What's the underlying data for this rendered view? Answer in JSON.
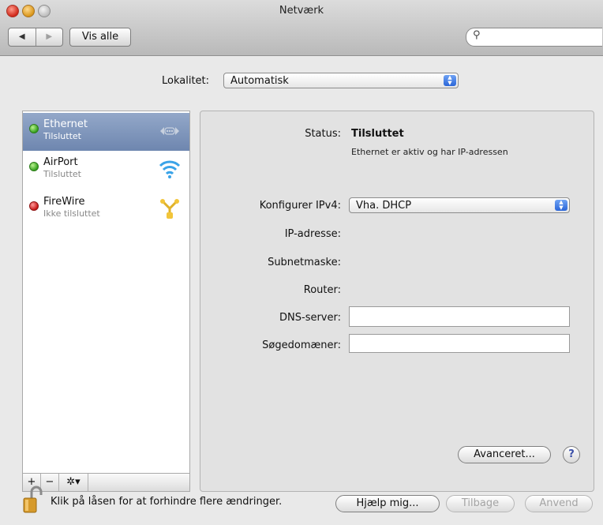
{
  "window": {
    "title": "Netværk"
  },
  "toolbar": {
    "back_glyph": "◀",
    "forward_glyph": "▶",
    "show_all_label": "Vis alle",
    "search_placeholder": ""
  },
  "location": {
    "label": "Lokalitet:",
    "value": "Automatisk"
  },
  "services": [
    {
      "name": "Ethernet",
      "status": "Tilsluttet",
      "status_color": "green",
      "icon": "ethernet-icon",
      "selected": true
    },
    {
      "name": "AirPort",
      "status": "Tilsluttet",
      "status_color": "green",
      "icon": "wifi-icon",
      "selected": false
    },
    {
      "name": "FireWire",
      "status": "Ikke tilsluttet",
      "status_color": "red",
      "icon": "firewire-icon",
      "selected": false
    }
  ],
  "sidebar_toolbar": {
    "add": "+",
    "remove": "−",
    "gear": "✲▾"
  },
  "detail": {
    "status_label": "Status:",
    "status_value": "Tilsluttet",
    "status_desc": "Ethernet er aktiv og har IP-adressen",
    "configure_label": "Konfigurer IPv4:",
    "configure_value": "Vha. DHCP",
    "ip_label": "IP-adresse:",
    "subnet_label": "Subnetmaske:",
    "router_label": "Router:",
    "dns_label": "DNS-server:",
    "dns_value": "",
    "search_domains_label": "Søgedomæner:",
    "search_domains_value": "",
    "advanced_label": "Avanceret...",
    "help_label": "?"
  },
  "footer": {
    "lock_text": "Klik på låsen for at forhindre flere ændringer.",
    "assist_label": "Hjælp mig...",
    "revert_label": "Tilbage",
    "apply_label": "Anvend"
  },
  "colors": {
    "selection": "#7f96bb",
    "status_green": "#2b9b16",
    "status_red": "#c40e0e",
    "accent_blue": "#2b66d8"
  }
}
